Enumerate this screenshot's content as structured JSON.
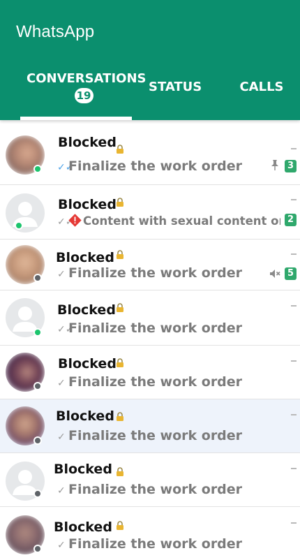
{
  "app": {
    "title": "WhatsApp"
  },
  "tabs": [
    {
      "label": "CONVERSATIONS",
      "count": "19",
      "active": true
    },
    {
      "label": "STATUS"
    },
    {
      "label": "CALLS"
    }
  ],
  "chats": [
    {
      "name": "Blocked",
      "preview": "Finalize the work order",
      "receipt": "read",
      "online": true,
      "avatar": "photo",
      "pinned": true,
      "unread": "3"
    },
    {
      "name": "Blocked",
      "preview": "Content with sexual content or...",
      "receipt": "delivered",
      "online": true,
      "avatar": "default",
      "warning": true,
      "unread": "2"
    },
    {
      "name": "Blocked",
      "preview": "Finalize the work order",
      "receipt": "sent",
      "online": false,
      "avatar": "photo",
      "muted": true,
      "unread": "5"
    },
    {
      "name": "Blocked",
      "preview": "Finalize the work order",
      "receipt": "delivered",
      "online": true,
      "avatar": "default"
    },
    {
      "name": "Blocked",
      "preview": "Finalize the work order",
      "receipt": "sent",
      "online": false,
      "avatar": "photo"
    },
    {
      "name": "Blocked",
      "preview": "Finalize the work order",
      "receipt": "sent",
      "online": false,
      "avatar": "photo",
      "selected": true
    },
    {
      "name": "Blocked",
      "preview": "Finalize the work order",
      "receipt": "sent",
      "online": false,
      "avatar": "default"
    },
    {
      "name": "Blocked",
      "preview": "Finalize the work order",
      "receipt": "sent",
      "online": false,
      "avatar": "photo"
    }
  ],
  "colors": {
    "header": "#0b8f6e",
    "online": "#1cc46d",
    "offline": "#5f6368",
    "unread_badge": "#2fa86c",
    "read_receipt": "#4fa3e8",
    "warning": "#e53935"
  },
  "icons": {
    "lock": "lock-icon",
    "pin": "pin-icon",
    "mute": "mute-icon",
    "warning": "warning-icon",
    "sent": "single-check-icon",
    "delivered": "double-check-icon"
  }
}
